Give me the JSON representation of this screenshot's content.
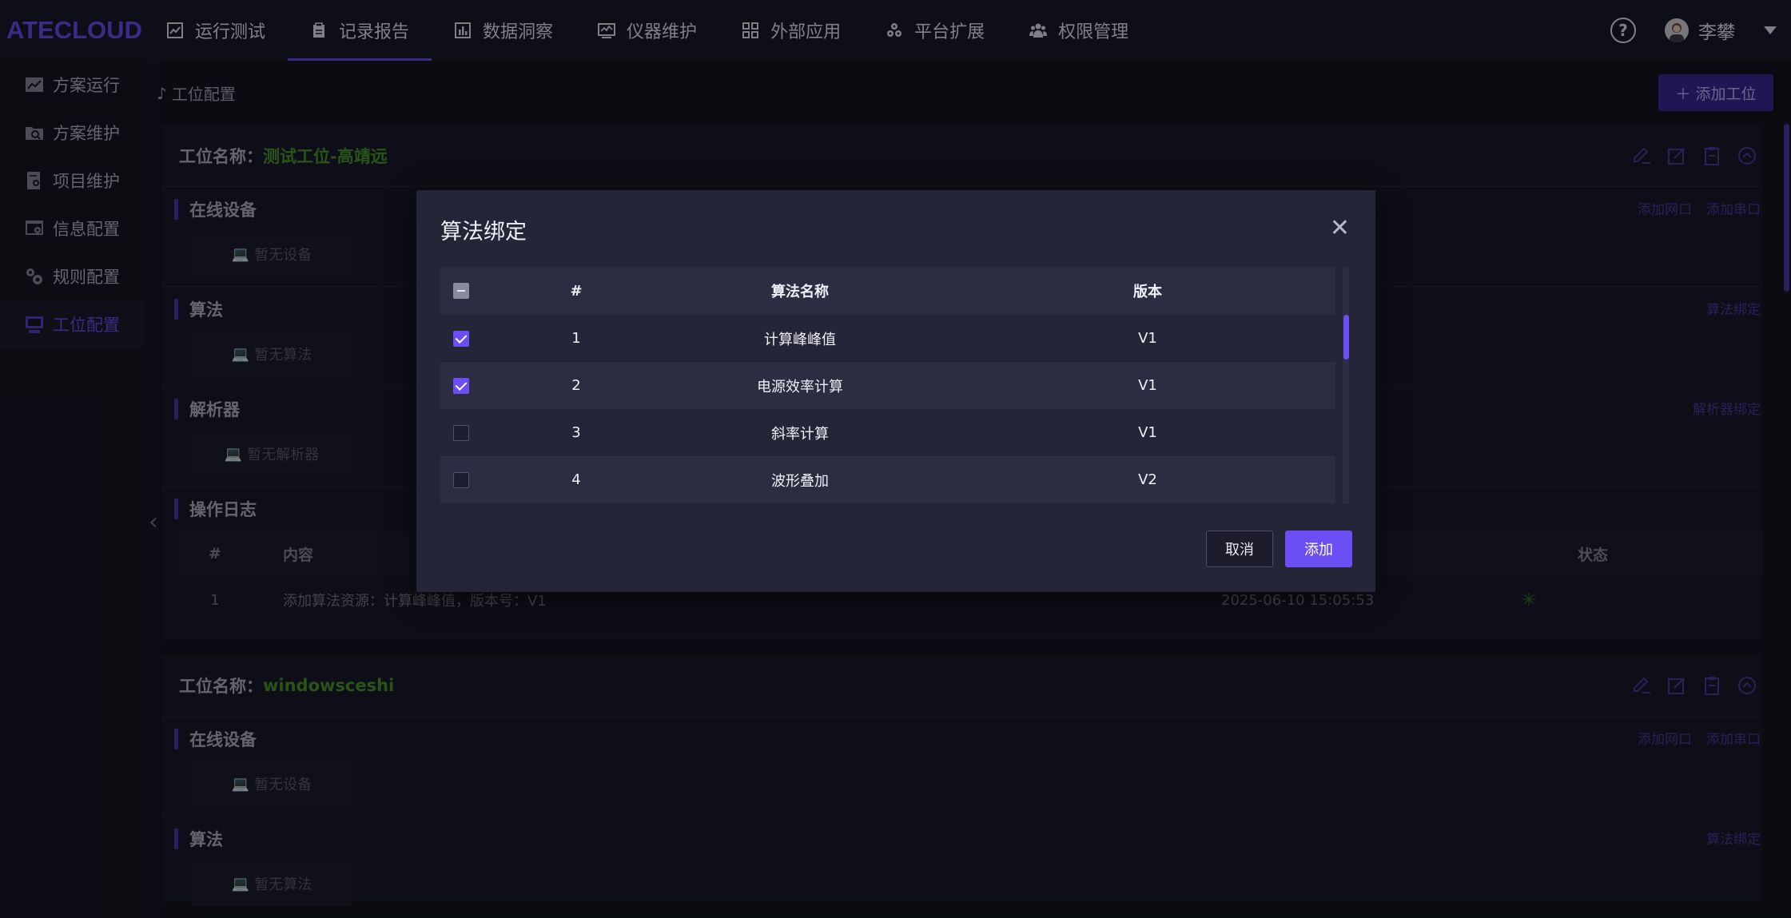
{
  "app": {
    "logo": "ATECLOUD"
  },
  "nav": [
    {
      "label": "运行测试",
      "icon": "chart-line-icon"
    },
    {
      "label": "记录报告",
      "icon": "clipboard-icon"
    },
    {
      "label": "数据洞察",
      "icon": "bar-chart-icon"
    },
    {
      "label": "仪器维护",
      "icon": "monitor-chart-icon"
    },
    {
      "label": "外部应用",
      "icon": "apps-grid-icon"
    },
    {
      "label": "平台扩展",
      "icon": "cubes-icon"
    },
    {
      "label": "权限管理",
      "icon": "users-icon"
    }
  ],
  "user": {
    "name": "李攀"
  },
  "sidebar": [
    {
      "label": "方案运行"
    },
    {
      "label": "方案维护"
    },
    {
      "label": "项目维护"
    },
    {
      "label": "信息配置"
    },
    {
      "label": "规则配置"
    },
    {
      "label": "工位配置"
    }
  ],
  "breadcrumb": "工位配置",
  "add_station_label": "添加工位",
  "station_label": "工位名称：",
  "stations": [
    {
      "name": "测试工位-高靖远"
    },
    {
      "name": "windowsceshi"
    }
  ],
  "sections": {
    "online_devices": "在线设备",
    "algorithm": "算法",
    "parser": "解析器",
    "op_log": "操作日志"
  },
  "links": {
    "add_net_port": "添加网口",
    "add_serial_port": "添加串口",
    "algo_bind": "算法绑定",
    "parser_bind": "解析器绑定"
  },
  "empty": {
    "no_device": "暂无设备",
    "no_algo": "暂无算法",
    "no_parser": "暂无解析器"
  },
  "log": {
    "headers": {
      "num": "#",
      "content": "内容",
      "status": "状态"
    },
    "rows": [
      {
        "num": "1",
        "content": "添加算法资源：计算峰峰值，版本号：V1",
        "time": "2025-06-10 15:05:53"
      }
    ]
  },
  "modal": {
    "title": "算法绑定",
    "headers": {
      "num": "#",
      "name": "算法名称",
      "version": "版本"
    },
    "rows": [
      {
        "num": "1",
        "name": "计算峰峰值",
        "version": "V1",
        "checked": true
      },
      {
        "num": "2",
        "name": "电源效率计算",
        "version": "V1",
        "checked": true
      },
      {
        "num": "3",
        "name": "斜率计算",
        "version": "V1",
        "checked": false
      },
      {
        "num": "4",
        "name": "波形叠加",
        "version": "V2",
        "checked": false
      }
    ],
    "cancel_label": "取消",
    "add_label": "添加"
  },
  "colors": {
    "accent": "#6c4ef5",
    "station_name": "#4a9a2a"
  }
}
